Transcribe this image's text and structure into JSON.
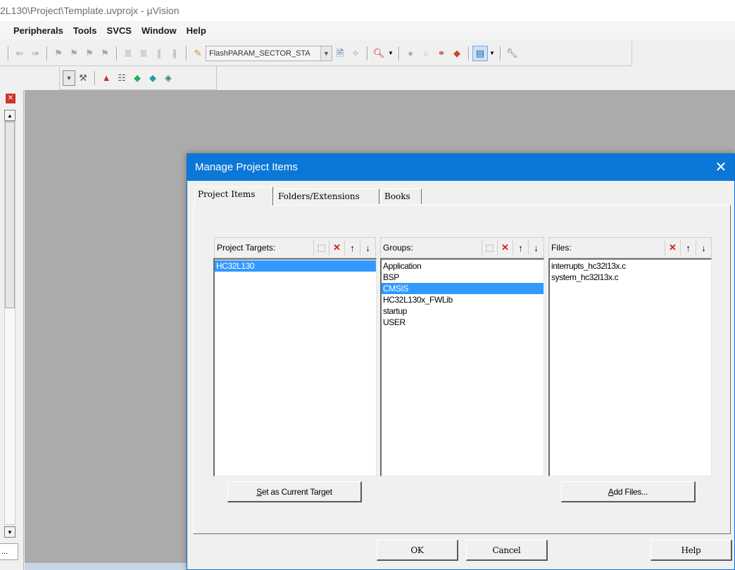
{
  "app": {
    "title": "2L130\\Project\\Template.uvprojx - µVision"
  },
  "menu": [
    "Peripherals",
    "Tools",
    "SVCS",
    "Window",
    "Help"
  ],
  "toolbar": {
    "flash_combo_value": "FlashPARAM_SECTOR_STA"
  },
  "left_panel": {
    "truncated_label": "..."
  },
  "dialog": {
    "title": "Manage Project Items",
    "tabs": [
      "Project Items",
      "Folders/Extensions",
      "Books"
    ],
    "project_targets": {
      "label": "Project Targets:",
      "items": [
        "HC32L130"
      ],
      "selected": "HC32L130"
    },
    "groups": {
      "label": "Groups:",
      "items": [
        "Application",
        "BSP",
        "CMSIS",
        "HC32L130x_FWLib",
        "startup",
        "USER"
      ],
      "selected": "CMSIS"
    },
    "files": {
      "label": "Files:",
      "items": [
        "interrupts_hc32l13x.c",
        "system_hc32l13x.c"
      ]
    },
    "buttons": {
      "set_current_mnemonic": "S",
      "set_current_rest": "et as Current Target",
      "add_files_mnemonic": "A",
      "add_files_rest": "dd Files...",
      "ok": "OK",
      "cancel": "Cancel",
      "help": "Help"
    }
  },
  "colors": {
    "title_bar": "#0b78d7",
    "selection": "#3399ff",
    "workspace": "#ababab"
  }
}
